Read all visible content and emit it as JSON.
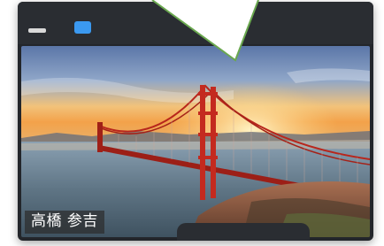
{
  "participant": {
    "name": "高橋 参吉"
  },
  "icons": {
    "minimize": "minimize-icon",
    "screen": "screen-share-icon",
    "pointer": "speech-pointer-icon"
  },
  "colors": {
    "tile_bg": "#23262b",
    "accent_blue": "#3b99f0",
    "pointer_border": "#6aa84f"
  }
}
